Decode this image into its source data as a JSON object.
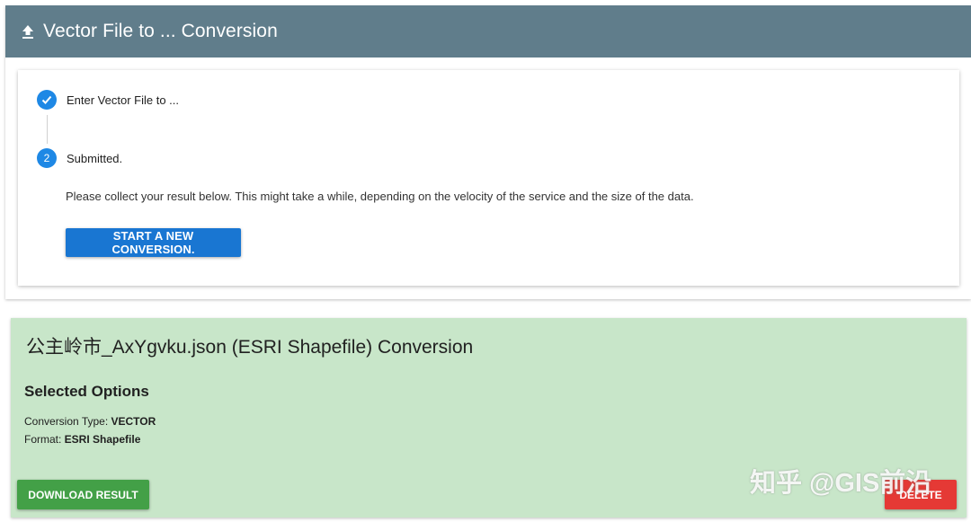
{
  "header": {
    "title": "Vector File to ... Conversion",
    "icon": "upload-icon",
    "bg_color": "#607d8b"
  },
  "stepper": {
    "steps": [
      {
        "label": "Enter Vector File to ...",
        "state": "completed",
        "icon": "check-icon"
      },
      {
        "number": "2",
        "label": "Submitted.",
        "state": "active"
      }
    ],
    "description": "Please collect your result below. This might take a while, depending on the velocity of the service and the size of the data.",
    "new_conversion_label": "START A NEW CONVERSION.",
    "accent_color": "#1e88e5"
  },
  "result": {
    "title": "公主岭市_AxYgvku.json (ESRI Shapefile) Conversion",
    "options_heading": "Selected Options",
    "conversion_type_label": "Conversion Type:",
    "conversion_type_value": "VECTOR",
    "format_label": "Format:",
    "format_value": "ESRI Shapefile",
    "download_label": "DOWNLOAD RESULT",
    "delete_label": "DELETE",
    "bg_color": "#c8e6c9",
    "download_color": "#43a047",
    "delete_color": "#e53935"
  },
  "watermark": {
    "text": "知乎 @GIS前沿"
  }
}
